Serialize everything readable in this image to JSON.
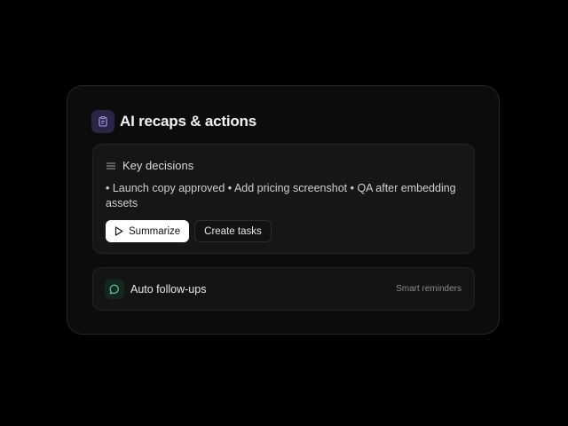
{
  "card": {
    "title": "AI recaps & actions",
    "icon": "clipboard-icon"
  },
  "decisions_panel": {
    "icon": "list-icon",
    "title": "Key decisions",
    "text": "• Launch copy approved • Add pricing screenshot • QA after embedding assets",
    "actions": {
      "primary_icon": "play-icon",
      "primary_label": "Summarize",
      "secondary_label": "Create tasks"
    }
  },
  "followups_row": {
    "icon": "chat-bubble-icon",
    "title": "Auto follow-ups",
    "meta": "Smart reminders"
  },
  "colors": {
    "background": "#000000",
    "card": "#0c0c0d",
    "accent_purple": "#2a2544",
    "accent_green": "#13261f",
    "primary_button": "#ffffff"
  }
}
